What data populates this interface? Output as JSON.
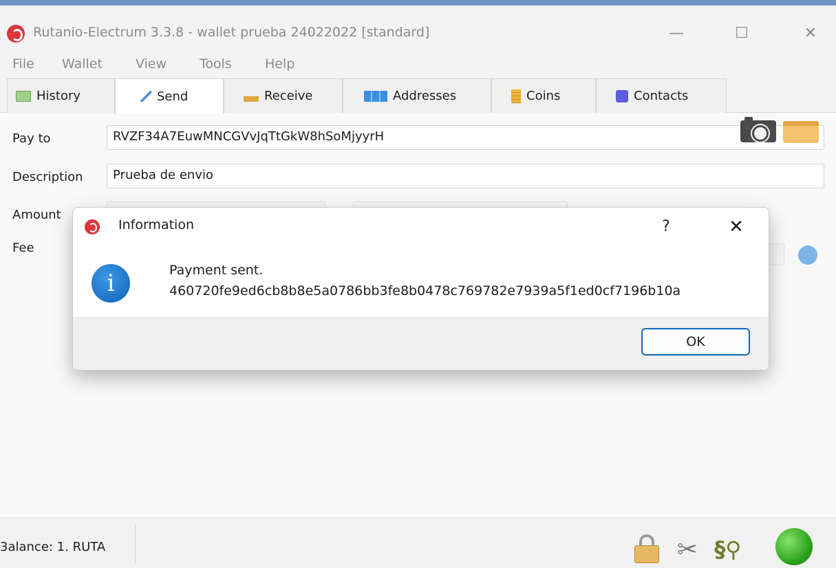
{
  "window": {
    "title": "Rutanio-Electrum 3.3.8  -  wallet prueba 24022022  [standard]",
    "minimize": "—",
    "maximize": "☐",
    "close": "✕"
  },
  "menu": [
    "File",
    "Wallet",
    "View",
    "Tools",
    "Help"
  ],
  "tabs": [
    {
      "label": "History",
      "icon": "history-icon"
    },
    {
      "label": "Send",
      "icon": "send-icon"
    },
    {
      "label": "Receive",
      "icon": "receive-icon"
    },
    {
      "label": "Addresses",
      "icon": "addresses-icon"
    },
    {
      "label": "Coins",
      "icon": "coins-icon"
    },
    {
      "label": "Contacts",
      "icon": "contacts-icon"
    }
  ],
  "active_tab": "Send",
  "form": {
    "pay_to_label": "Pay to",
    "pay_to_value": "RVZF34A7EuwMNCGVvJqTtGkW8hSoMjyyrH",
    "description_label": "Description",
    "description_value": "Prueba de envio",
    "amount_label": "Amount",
    "fee_label": "Fee"
  },
  "status": {
    "balance": "3alance: 1. RUTA"
  },
  "dialog": {
    "title": "Information",
    "help": "?",
    "close": "✕",
    "info_glyph": "i",
    "message_line1": "Payment sent.",
    "message_line2": "460720fe9ed6cb8b8e5a0786bb3fe8b0478c769782e7939a5f1ed0cf7196b10a",
    "ok_label": "OK"
  },
  "colors": {
    "accent": "#0f6cbd",
    "logo": "#d9363e",
    "status_online": "#2aa11a"
  }
}
